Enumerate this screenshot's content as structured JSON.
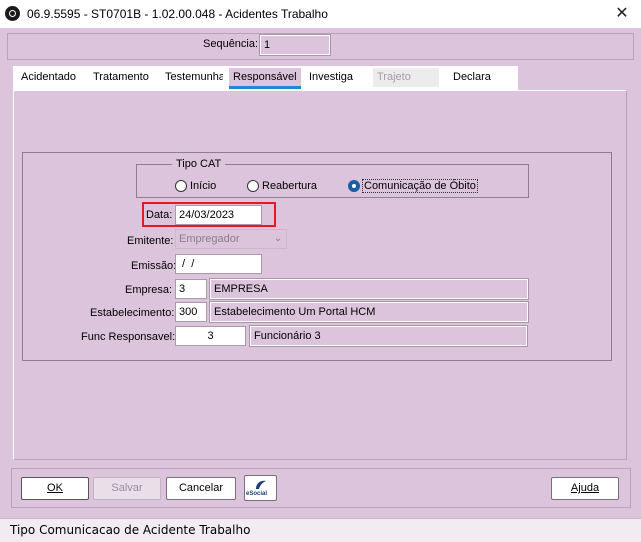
{
  "window": {
    "title": "06.9.5595 - ST0701B - 1.02.00.048 - Acidentes Trabalho",
    "close_glyph": "✕"
  },
  "header": {
    "sequencia_label": "Sequência:",
    "sequencia_value": "1"
  },
  "tabs": [
    {
      "label": "Acidentado",
      "state": "normal"
    },
    {
      "label": "Tratamento",
      "state": "normal"
    },
    {
      "label": "Testemunha",
      "state": "normal"
    },
    {
      "label": "Responsável",
      "state": "active"
    },
    {
      "label": "Investiga",
      "state": "normal"
    },
    {
      "label": "Trajeto",
      "state": "disabled"
    },
    {
      "label": "Declara",
      "state": "normal"
    }
  ],
  "form": {
    "tipo_cat": {
      "title": "Tipo CAT",
      "options": [
        "Início",
        "Reabertura",
        "Comunicação de Óbito"
      ],
      "selected": "Comunicação de Óbito"
    },
    "data_label": "Data:",
    "data_value": "24/03/2023",
    "emitente_label": "Emitente:",
    "emitente_value": "Empregador",
    "emissao_label": "Emissão:",
    "emissao_value": " /  /",
    "empresa_label": "Empresa:",
    "empresa_code": "3",
    "empresa_name": "EMPRESA",
    "estabelecimento_label": "Estabelecimento:",
    "estabelecimento_code": "300",
    "estabelecimento_name": "Estabelecimento Um Portal HCM",
    "func_label": "Func Responsavel:",
    "func_code": "3",
    "func_name": "Funcionário 3"
  },
  "buttons": {
    "ok": "OK",
    "salvar": "Salvar",
    "cancelar": "Cancelar",
    "esocial": "eSocial",
    "ajuda": "Ajuda"
  },
  "status_bar": {
    "text": "Tipo Comunicacao de Acidente Trabalho"
  },
  "colors": {
    "background": "#dcc5dc",
    "highlight_box": "#e01b24",
    "active_tab_underline": "#1e88d4",
    "radio_selected": "#1b5ea8"
  }
}
